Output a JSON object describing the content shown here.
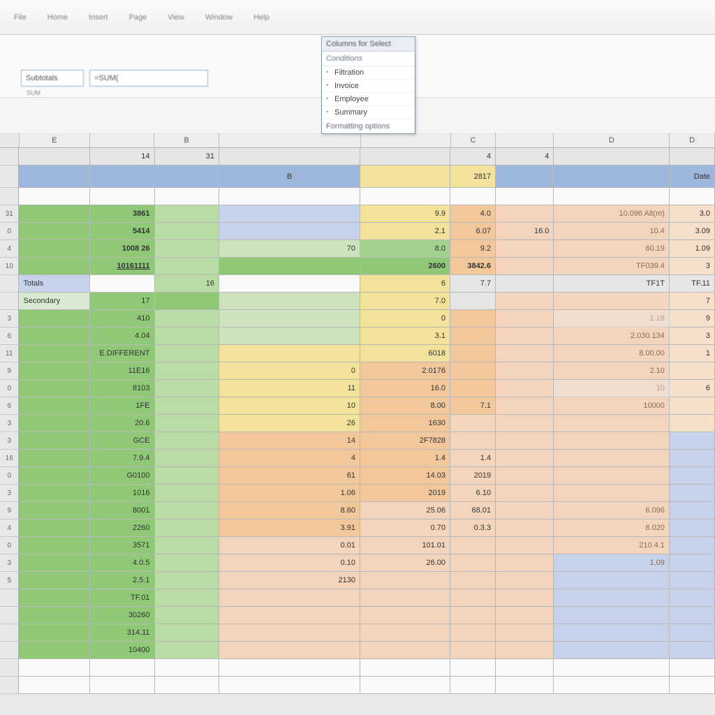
{
  "ribbon": {
    "items": [
      "File",
      "Home",
      "Insert",
      "Page",
      "View",
      "Window",
      "Help"
    ]
  },
  "dropdown": {
    "header": "Columns for Select",
    "section": "Conditions",
    "items": [
      "Filtration",
      "Invoice",
      "Employee",
      "Summary"
    ],
    "footer": "Formatting options"
  },
  "name_box": {
    "label": "Subtotals",
    "below": "SUM"
  },
  "formula_bar": {
    "value": "=SUM("
  },
  "columns": [
    "E",
    "",
    "B",
    "",
    "",
    "C",
    "",
    "D",
    "D"
  ],
  "header_row1": {
    "b": "14",
    "c": "31",
    "f": "4",
    "g": "4"
  },
  "header_row2": {
    "d": "B",
    "f": "2817",
    "i": "Date"
  },
  "row_labels": {
    "r3": "31",
    "r4": "0",
    "r5": "4",
    "r6": "10",
    "r7": "Totals",
    "r8": "Secondary",
    "r9": "3",
    "r10": "6",
    "r11": "11",
    "r12": "9",
    "r13": "0",
    "r14": "6",
    "r15": "3",
    "r16": "3",
    "r17": "16",
    "r18": "0",
    "r19": "3",
    "r20": "9",
    "r21": "4",
    "r22": "0",
    "r23": "3",
    "r24": "5"
  },
  "colA": {
    "r3": "",
    "r4": "",
    "r5": "",
    "r6": "",
    "r7": "Totals",
    "r8": "Secondary",
    "r9": "",
    "r10": "",
    "r11": "",
    "r12": "",
    "r13": "",
    "r14": "",
    "r15": "",
    "r16": "",
    "r17": "",
    "r18": "",
    "r19": "",
    "r20": "",
    "r21": "",
    "r22": "",
    "r23": "",
    "r24": ""
  },
  "colB": {
    "r3": "3861",
    "r4": "5414",
    "r5": "1008  26",
    "r6": "10161111",
    "r7": "",
    "r8": "17",
    "r9": "410",
    "r10": "4.04",
    "r11": "E.DIFFERENT",
    "r12": "11E16",
    "r13": "8103",
    "r14": "1FE",
    "r15": "20.6",
    "r16": "GCE",
    "r17": "7.9.4",
    "r18": "G0100",
    "r19": "1016",
    "r20": "8001",
    "r21": "2260",
    "r22": "3571",
    "r23": "4.0.5",
    "r24": "2.5.1",
    "r25": "TF.01",
    "r26": "30260",
    "r27": "314.11",
    "r28": "10400"
  },
  "colC": {
    "r7": "16",
    "r8": ""
  },
  "colD": {
    "r4": "",
    "r5": "70",
    "r6": "",
    "r12": "0",
    "r13": "11",
    "r14": "10",
    "r15": "26",
    "r16": "14",
    "r17": "4",
    "r18": "61",
    "r19": "1.06",
    "r20": "8.60",
    "r21": "3.91",
    "r22": "0.01",
    "r23": "0.10",
    "r24": "2130"
  },
  "colE": {
    "r1": "4",
    "r2": "2817",
    "r3": "9.9",
    "r4": "2.1",
    "r5": "8.0",
    "r6": "2600",
    "r7": "6",
    "r8": "7.0",
    "r9": "0",
    "r10": "3.1",
    "r11": "6018",
    "r12": "2.0176",
    "r13": "16.0",
    "r14": "8.00",
    "r15": "1630",
    "r16": "2F7828",
    "r17": "1.4",
    "r18": "14.03",
    "r19": "2019",
    "r20": "25.06",
    "r21": "0.70",
    "r22": "101.01",
    "r23": "26.00"
  },
  "colF": {
    "r1": "4",
    "r3": "4.0",
    "r4": "6.07",
    "r5": "9.2",
    "r6": "3842.6",
    "r7": "7.7",
    "r9": "",
    "r10": "",
    "r11": "",
    "r12": "",
    "r13": "",
    "r14": "7.1",
    "r15": "",
    "r16": "",
    "r17": "1.4",
    "r18": "2019",
    "r19": "6.10",
    "r20": "68.01",
    "r21": "0.3.3",
    "r22": "",
    "r23": ""
  },
  "colG": {
    "r3": "",
    "r4": "16.0",
    "r6": "",
    "r7": "",
    "r18": "",
    "r19": ""
  },
  "colH": {
    "r3": "10.096  Alt(m)",
    "r4": "10.4",
    "r5": "60.19",
    "r6": "TF039.4",
    "r7": "TF1T",
    "r9": "1.18",
    "r10": "2.030.134",
    "r11": "8.00.00",
    "r12": "2.10",
    "r13": "10",
    "r14": "10000",
    "r20": "6.096",
    "r21": "8.020",
    "r22": "210.4.1",
    "r23": "1.09"
  },
  "colI": {
    "r2": "Date",
    "r3": "3.0",
    "r4": "3.09",
    "r5": "1.09",
    "r6": "3",
    "r7": "TF.11",
    "r8": "7",
    "r9": "9",
    "r10": "3",
    "r11": "1",
    "r13": "6"
  }
}
